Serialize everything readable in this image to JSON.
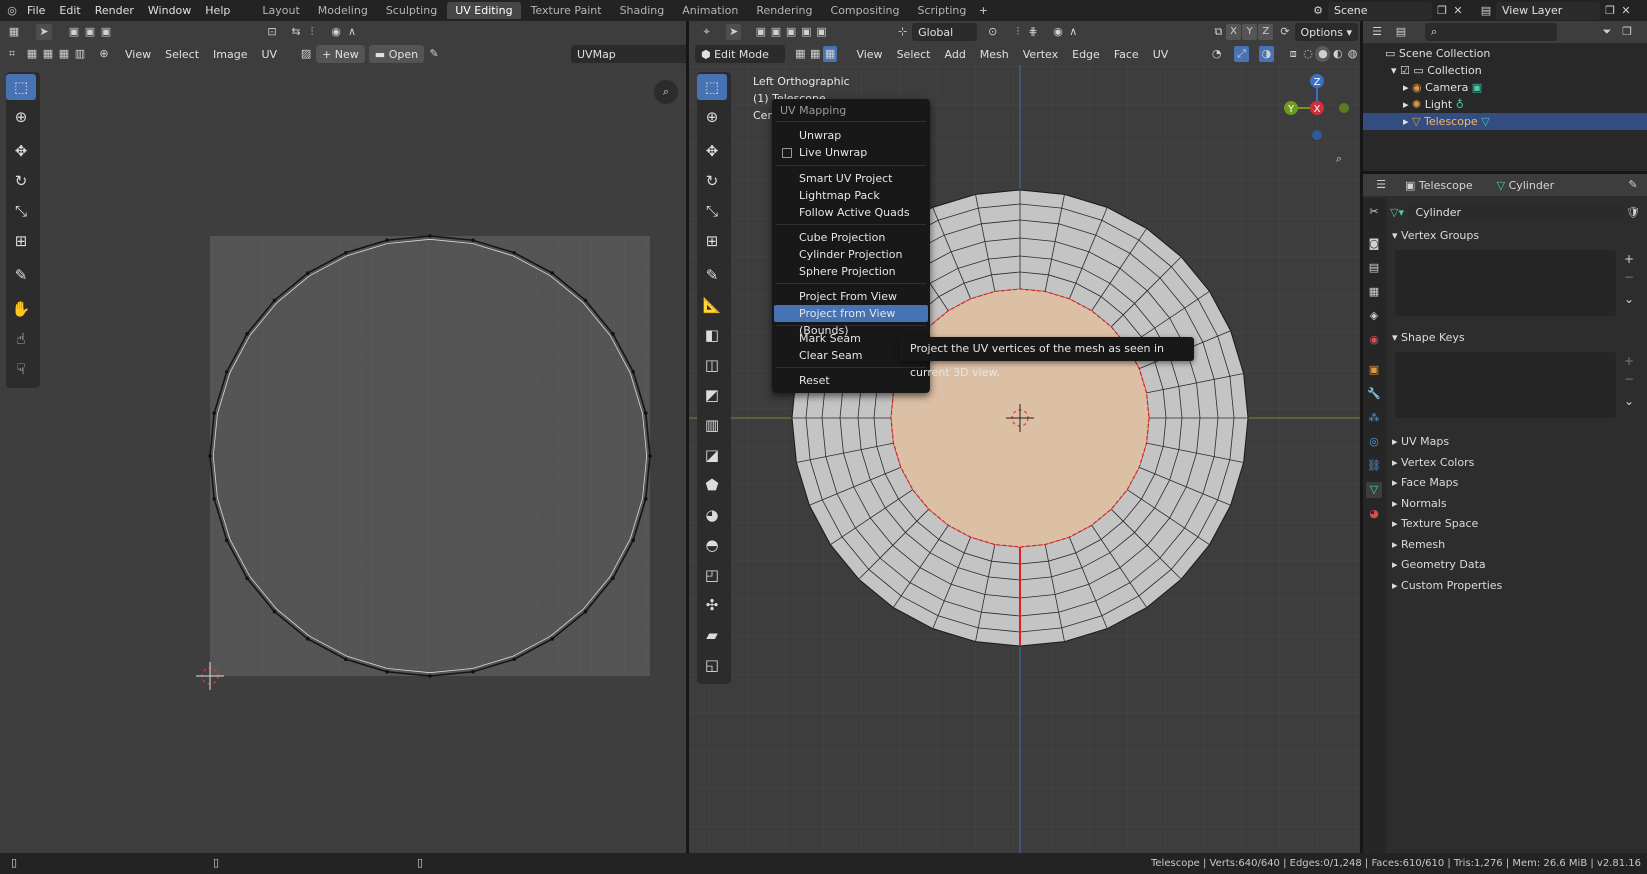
{
  "topbar": {
    "menus": [
      "File",
      "Edit",
      "Render",
      "Window",
      "Help"
    ],
    "workspaces": [
      "Layout",
      "Modeling",
      "Sculpting",
      "UV Editing",
      "Texture Paint",
      "Shading",
      "Animation",
      "Rendering",
      "Compositing",
      "Scripting"
    ],
    "active_workspace": "UV Editing",
    "scene": "Scene",
    "view_layer": "View Layer"
  },
  "uv_editor": {
    "menus": [
      "View",
      "Select",
      "Image",
      "UV"
    ],
    "new_label": "New",
    "open_label": "Open",
    "uvmap": "UVMap"
  },
  "viewport": {
    "transform": "Global",
    "options": "Options",
    "mode": "Edit Mode",
    "menus": [
      "View",
      "Select",
      "Add",
      "Mesh",
      "Vertex",
      "Edge",
      "Face",
      "UV"
    ],
    "overlay_line1": "Left Orthographic",
    "overlay_line2": "(1) Telescope",
    "overlay_line3": "Cent",
    "axis_x": "X",
    "axis_y": "Y",
    "axis_z": "Z"
  },
  "uv_menu": {
    "title": "UV Mapping",
    "items": {
      "unwrap": "Unwrap",
      "live_unwrap": "Live Unwrap",
      "smart_uv": "Smart UV Project",
      "lightmap": "Lightmap Pack",
      "follow_quads": "Follow Active Quads",
      "cube": "Cube Projection",
      "cylinder": "Cylinder Projection",
      "sphere": "Sphere Projection",
      "project_view": "Project From View",
      "project_view_bounds": "Project from View (Bounds)",
      "mark_seam": "Mark Seam",
      "clear_seam": "Clear Seam",
      "reset": "Reset"
    }
  },
  "tooltip": "Project the UV vertices of the mesh as seen in current 3D view.",
  "outliner": {
    "scene_collection": "Scene Collection",
    "collection": "Collection",
    "camera": "Camera",
    "light": "Light",
    "telescope": "Telescope"
  },
  "properties": {
    "object": "Telescope",
    "data": "Cylinder",
    "mesh_name": "Cylinder",
    "panels": {
      "vertex_groups": "Vertex Groups",
      "shape_keys": "Shape Keys",
      "uv_maps": "UV Maps",
      "vertex_colors": "Vertex Colors",
      "face_maps": "Face Maps",
      "normals": "Normals",
      "texture_space": "Texture Space",
      "remesh": "Remesh",
      "geometry_data": "Geometry Data",
      "custom_properties": "Custom Properties"
    }
  },
  "statusbar": "Telescope | Verts:640/640 | Edges:0/1,248 | Faces:610/610 | Tris:1,276 | Mem: 26.6 MiB | v2.81.16",
  "colors": {
    "accent": "#4772b3",
    "face_selected": "#dcc0a6",
    "seam": "#e02020"
  }
}
